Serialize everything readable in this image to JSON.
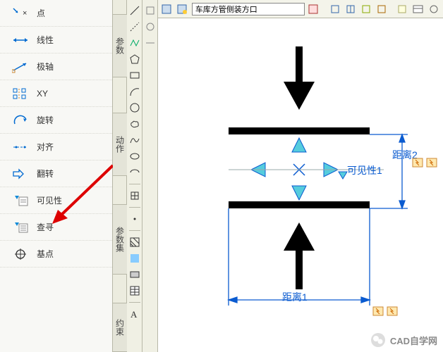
{
  "palette": {
    "items": [
      {
        "label": "点"
      },
      {
        "label": "线性"
      },
      {
        "label": "极轴"
      },
      {
        "label": "XY"
      },
      {
        "label": "旋转"
      },
      {
        "label": "对齐"
      },
      {
        "label": "翻转"
      },
      {
        "label": "可见性"
      },
      {
        "label": "查寻"
      },
      {
        "label": "基点"
      }
    ]
  },
  "side_tabs": {
    "tab1": "参数",
    "tab2": "动作",
    "tab3": "参数集",
    "tab4": "约束"
  },
  "top": {
    "dropdown_value": "车库方管侧装方口"
  },
  "canvas": {
    "visibility_label": "可见性1",
    "dist1_label": "距离1",
    "dist2_label": "距离2"
  },
  "watermark": {
    "text": "CAD自学网"
  }
}
